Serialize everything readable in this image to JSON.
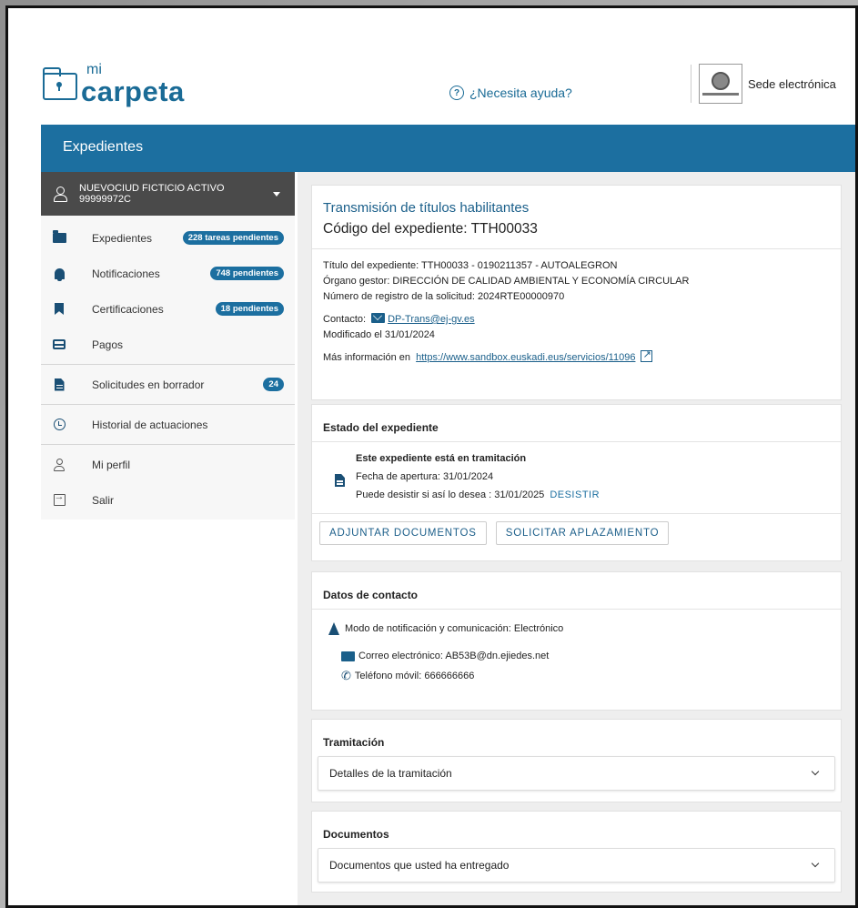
{
  "header": {
    "logo_mi": "mi",
    "logo_carpeta": "carpeta",
    "help_label": "¿Necesita ayuda?",
    "sede_label": "Sede electrónica"
  },
  "bluebar": {
    "title": "Expedientes"
  },
  "user": {
    "name": "NUEVOCIUD FICTICIO ACTIVO",
    "id": "99999972C"
  },
  "sidebar": {
    "items": [
      {
        "label": "Expedientes",
        "badge": "228 tareas pendientes",
        "icon": "folder-icon"
      },
      {
        "label": "Notificaciones",
        "badge": "748 pendientes",
        "icon": "bell-icon"
      },
      {
        "label": "Certificaciones",
        "badge": "18 pendientes",
        "icon": "bookmark-icon"
      },
      {
        "label": "Pagos",
        "icon": "card-icon"
      },
      {
        "label": "Solicitudes en borrador",
        "badge": "24",
        "icon": "document-icon"
      },
      {
        "label": "Historial de actuaciones",
        "icon": "history-icon"
      },
      {
        "label": "Mi perfil",
        "icon": "user-icon"
      },
      {
        "label": "Salir",
        "icon": "exit-icon"
      }
    ]
  },
  "expediente": {
    "title": "Transmisión de títulos habilitantes",
    "code": "Código del expediente: TTH00033",
    "titulo": "Título del expediente: TTH00033 - 0190211357 - AUTOALEGRON",
    "organo": "Órgano gestor: DIRECCIÓN DE CALIDAD AMBIENTAL Y ECONOMÍA CIRCULAR",
    "registro": "Número de registro de la solicitud: 2024RTE00000970",
    "contacto_label": "Contacto:",
    "contacto_email": "DP-Trans@ej-gv.es",
    "modificado": "Modificado el 31/01/2024",
    "mas_info_label": "Más información en",
    "mas_info_url": "https://www.sandbox.euskadi.eus/servicios/11096"
  },
  "estado": {
    "title": "Estado del expediente",
    "status": "Este expediente está en tramitación",
    "fecha": "Fecha de apertura: 31/01/2024",
    "desistir_text": "Puede desistir si así lo desea : 31/01/2025",
    "desistir_link": "DESISTIR",
    "btn_adjuntar": "ADJUNTAR DOCUMENTOS",
    "btn_aplazamiento": "SOLICITAR APLAZAMIENTO"
  },
  "contacto": {
    "title": "Datos de contacto",
    "modo": "Modo de notificación y comunicación: Electrónico",
    "correo": "Correo electrónico: AB53B@dn.ejiedes.net",
    "telefono": "Teléfono móvil: 666666666"
  },
  "tramitacion": {
    "title": "Tramitación",
    "accordion": "Detalles de la tramitación"
  },
  "documentos": {
    "title": "Documentos",
    "accordion": "Documentos que usted ha entregado"
  },
  "colors": {
    "brand": "#1c6fa0",
    "user_bar": "#4a4a4a"
  }
}
